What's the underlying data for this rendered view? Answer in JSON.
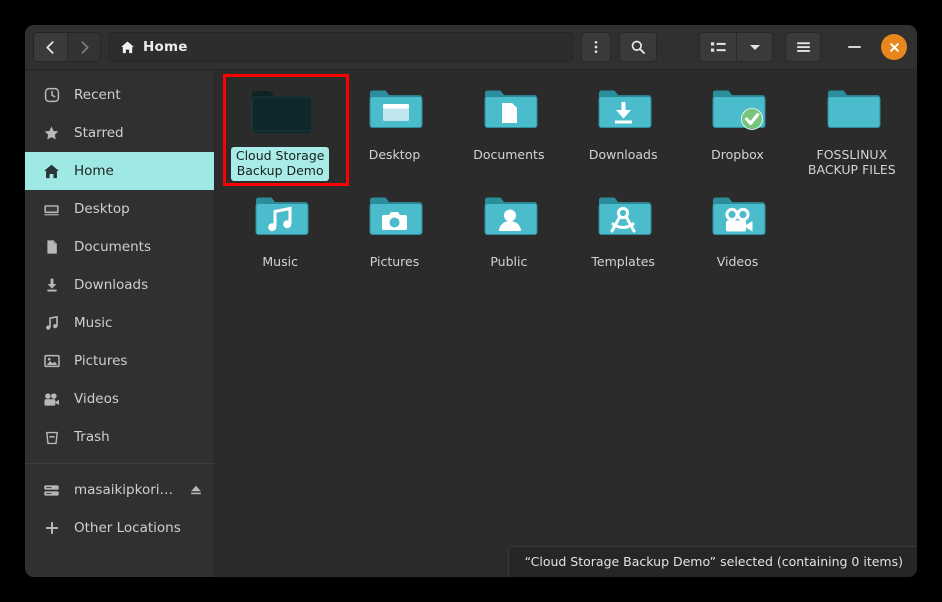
{
  "window": {
    "title": "Home"
  },
  "headerbar": {
    "back_label": "Back",
    "forward_label": "Forward",
    "path_label": "Home",
    "path_icon": "home-icon",
    "kebab_label": "Path options",
    "search_label": "Search",
    "view_list_label": "View options",
    "view_dropdown_label": "Sort options",
    "menu_label": "Main menu",
    "minimize_label": "Minimize",
    "close_label": "Close",
    "close_color": "#e8871e"
  },
  "sidebar": {
    "items": [
      {
        "label": "Recent",
        "icon": "clock-icon",
        "selected": false
      },
      {
        "label": "Starred",
        "icon": "star-icon",
        "selected": false
      },
      {
        "label": "Home",
        "icon": "home-icon",
        "selected": true
      },
      {
        "label": "Desktop",
        "icon": "desktop-icon",
        "selected": false
      },
      {
        "label": "Documents",
        "icon": "document-icon",
        "selected": false
      },
      {
        "label": "Downloads",
        "icon": "download-icon",
        "selected": false
      },
      {
        "label": "Music",
        "icon": "music-note-icon",
        "selected": false
      },
      {
        "label": "Pictures",
        "icon": "image-icon",
        "selected": false
      },
      {
        "label": "Videos",
        "icon": "video-icon",
        "selected": false
      },
      {
        "label": "Trash",
        "icon": "trash-icon",
        "selected": false
      }
    ],
    "device": {
      "label": "masaikipkorir…",
      "icon": "drive-icon",
      "eject_icon": "eject-icon"
    },
    "other_locations": {
      "label": "Other Locations",
      "icon": "plus-icon"
    },
    "selection_color": "#9fe9e4"
  },
  "content": {
    "folder_color": "#4bb8c7",
    "items": [
      {
        "name": "Cloud Storage\nBackup Demo",
        "emblem": "none",
        "selected": true
      },
      {
        "name": "Desktop",
        "emblem": "desktop",
        "selected": false
      },
      {
        "name": "Documents",
        "emblem": "document",
        "selected": false
      },
      {
        "name": "Downloads",
        "emblem": "download",
        "selected": false
      },
      {
        "name": "Dropbox",
        "emblem": "check",
        "selected": false
      },
      {
        "name": "FOSSLINUX\nBACKUP FILES",
        "emblem": "plain",
        "selected": false
      },
      {
        "name": "Music",
        "emblem": "music",
        "selected": false
      },
      {
        "name": "Pictures",
        "emblem": "camera",
        "selected": false
      },
      {
        "name": "Public",
        "emblem": "person",
        "selected": false
      },
      {
        "name": "Templates",
        "emblem": "templates",
        "selected": false
      },
      {
        "name": "Videos",
        "emblem": "video",
        "selected": false
      }
    ]
  },
  "statusbar": {
    "text": "“Cloud Storage Backup Demo” selected  (containing 0 items)"
  },
  "annotation": {
    "color": "#ff0000",
    "target": "Cloud Storage Backup Demo"
  }
}
